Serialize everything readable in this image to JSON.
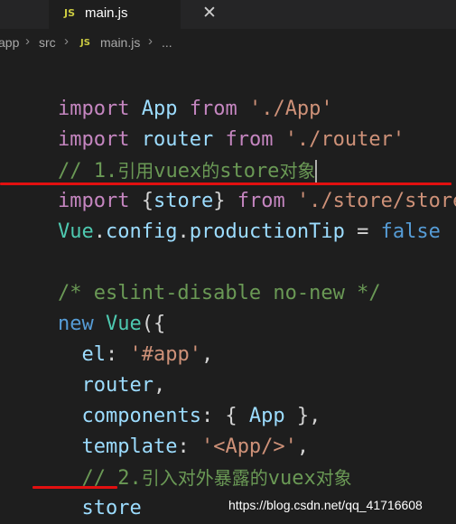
{
  "tab": {
    "icon": "JS",
    "label": "main.js",
    "close": "✕"
  },
  "breadcrumb": {
    "part1": "app",
    "part2": "src",
    "icon": "JS",
    "part3": "main.js",
    "ellipsis": "...",
    "sep": "›"
  },
  "code": {
    "l1": {
      "a": "import",
      "b": " ",
      "c": "App",
      "d": " ",
      "e": "from",
      "f": " ",
      "g": "'./App'"
    },
    "l2": {
      "a": "import",
      "b": " ",
      "c": "router",
      "d": " ",
      "e": "from",
      "f": " ",
      "g": "'./router'"
    },
    "l3": {
      "a": "// 1.",
      "b": "引用",
      "c": "vuex",
      "d": "的",
      "e": "store",
      "f": "对象"
    },
    "l4": {
      "a": "import",
      "b": " ",
      "c": "{",
      "d": "store",
      "e": "}",
      "f": " ",
      "g": "from",
      "h": " ",
      "i": "'./store/store'"
    },
    "l5": {
      "a": "Vue",
      "b": ".",
      "c": "config",
      "d": ".",
      "e": "productionTip",
      "f": " = ",
      "g": "false"
    },
    "l7": {
      "a": "/* eslint-disable no-new */"
    },
    "l8": {
      "a": "new",
      "b": " ",
      "c": "Vue",
      "d": "({"
    },
    "l9": {
      "a": "  ",
      "b": "el",
      "c": ": ",
      "d": "'#app'",
      "e": ","
    },
    "l10": {
      "a": "  ",
      "b": "router",
      "c": ","
    },
    "l11": {
      "a": "  ",
      "b": "components",
      "c": ": { ",
      "d": "App",
      "e": " },"
    },
    "l12": {
      "a": "  ",
      "b": "template",
      "c": ": ",
      "d": "'<App/>'",
      "e": ","
    },
    "l13": {
      "a": "  // 2.",
      "b": "引入对外暴露的",
      "c": "vuex",
      "d": "对象"
    },
    "l14": {
      "a": "  ",
      "b": "store"
    },
    "l15": {
      "a": "})"
    }
  },
  "watermark": "https://blog.csdn.net/qq_41716608",
  "colors": {
    "keyword": "#569cd6",
    "control": "#c586c0",
    "string": "#ce9178",
    "comment": "#6a9955",
    "variable": "#9cdcfe",
    "class": "#4ec9b0",
    "annotation": "#e21010"
  }
}
